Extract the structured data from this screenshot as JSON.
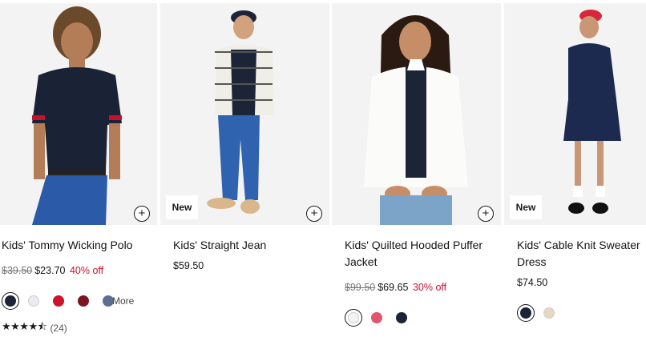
{
  "products": [
    {
      "name": "Kids' Tommy Wicking Polo",
      "original_price": "$39.50",
      "sale_price": "$23.70",
      "discount": "40% off",
      "swatch_colors": [
        "#1c2438",
        "#e9ebf1",
        "#d0112b",
        "#7b1520"
      ],
      "more_color": "#5a6f92",
      "more_label": "More",
      "rating_stars": "★★★★⯪",
      "rating_value": 4.5,
      "review_count": "(24)"
    },
    {
      "badge": "New",
      "name": "Kids' Straight Jean",
      "price": "$59.50"
    },
    {
      "name": "Kids' Quilted Hooded Puffer Jacket",
      "original_price": "$99.50",
      "sale_price": "$69.65",
      "discount": "30% off",
      "swatch_colors": [
        "#f2f2f2",
        "#e0566c",
        "#1c2438"
      ]
    },
    {
      "badge": "New",
      "name": "Kids' Cable Knit Sweater Dress",
      "price": "$74.50",
      "swatch_colors": [
        "#1c2438",
        "#e8d6c0"
      ]
    }
  ],
  "quick_add_symbol": "+"
}
